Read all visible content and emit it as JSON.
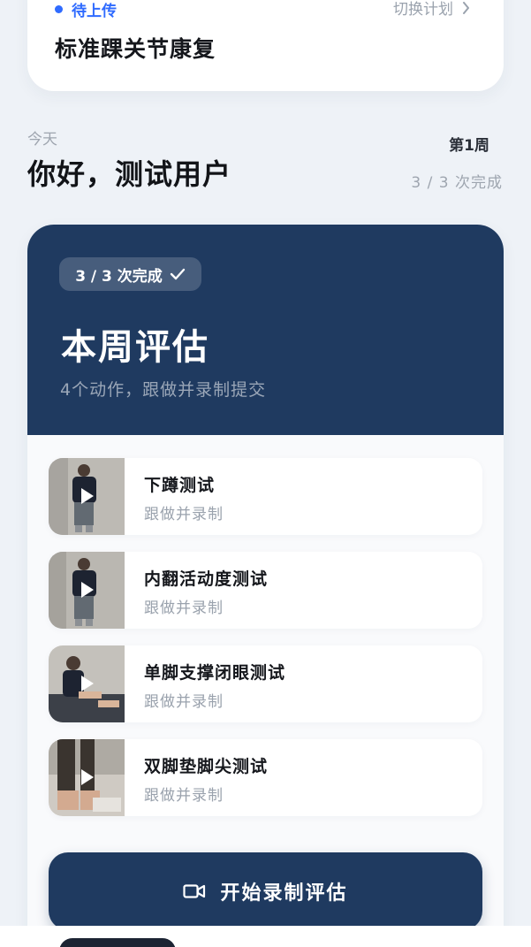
{
  "plan": {
    "status": "待上传",
    "switch_label": "切换计划",
    "title": "标准踝关节康复"
  },
  "greeting": {
    "today": "今天",
    "hello": "你好，测试用户",
    "week": "第1周",
    "progress": "3 / 3 次完成"
  },
  "assessment": {
    "badge": "3 / 3 次完成",
    "title": "本周评估",
    "subtitle": "4个动作，跟做并录制提交",
    "items": [
      {
        "name": "下蹲测试",
        "sub": "跟做并录制"
      },
      {
        "name": "内翻活动度测试",
        "sub": "跟做并录制"
      },
      {
        "name": "单脚支撑闭眼测试",
        "sub": "跟做并录制"
      },
      {
        "name": "双脚垫脚尖测试",
        "sub": "跟做并录制"
      }
    ],
    "start_label": "开始录制评估"
  },
  "colors": {
    "accent_blue": "#2f6bff",
    "navy": "#1f3a60",
    "background": "#eef2f7"
  },
  "icons": {
    "status": "status-dot-icon",
    "switch": "chevron-right-icon",
    "badge": "checkmark-icon",
    "play": "play-icon",
    "record": "video-camera-icon"
  }
}
